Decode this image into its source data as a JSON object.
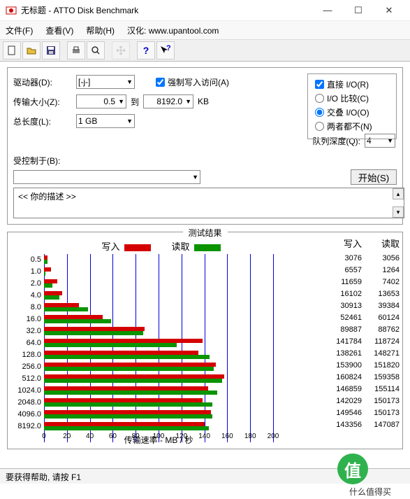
{
  "window": {
    "title": "无标题 - ATTO Disk Benchmark"
  },
  "menu": {
    "file": "文件(F)",
    "view": "查看(V)",
    "help": "帮助(H)",
    "trans_label": "汉化:",
    "trans_url": "www.upantool.com"
  },
  "labels": {
    "drive": "驱动器(D):",
    "transfer": "传输大小(Z):",
    "to": "到",
    "kb": "KB",
    "length": "总长度(L):",
    "force_write": "强制写入访问(A)",
    "direct_io": "直接 I/O(R)",
    "io_compare": "I/O 比较(C)",
    "overlap_io": "交叠 I/O(O)",
    "neither": "两者都不(N)",
    "queue_depth": "队列深度(Q):",
    "controlled": "受控制于(B):",
    "start": "开始(S)",
    "desc": "<<   你的描述   >>",
    "results_title": "测试结果",
    "write": "写入",
    "read": "读取",
    "xaxis": "传输速率 - MB / 秒",
    "status": "要获得帮助, 请按 F1"
  },
  "values": {
    "drive": "[-j-]",
    "size_from": "0.5",
    "size_to": "8192.0",
    "length": "1 GB",
    "queue": "4"
  },
  "watermark": {
    "symbol": "值",
    "text": "什么值得买"
  },
  "chart_data": {
    "type": "bar",
    "xlabel": "传输速率 - MB / 秒",
    "xlim": [
      0,
      200
    ],
    "xticks": [
      0,
      20,
      40,
      60,
      80,
      100,
      120,
      140,
      160,
      180,
      200
    ],
    "categories": [
      "0.5",
      "1.0",
      "2.0",
      "4.0",
      "8.0",
      "16.0",
      "32.0",
      "64.0",
      "128.0",
      "256.0",
      "512.0",
      "1024.0",
      "2048.0",
      "4096.0",
      "8192.0"
    ],
    "series": [
      {
        "name": "写入",
        "color": "#d40000",
        "values_kb": [
          3076,
          6557,
          11659,
          16102,
          30913,
          52461,
          89887,
          141784,
          138261,
          153900,
          160824,
          146859,
          142029,
          149546,
          143356
        ],
        "bar_mb": [
          3.0,
          6.4,
          11.4,
          15.7,
          30.2,
          51.2,
          87.8,
          138.5,
          135.0,
          150.3,
          157.1,
          143.4,
          138.7,
          146.0,
          140.0
        ]
      },
      {
        "name": "读取",
        "color": "#0a9400",
        "values_kb": [
          3056,
          1264,
          7402,
          13653,
          39384,
          60124,
          88762,
          118724,
          148271,
          151820,
          159358,
          155114,
          150173,
          150173,
          147087
        ],
        "bar_mb": [
          3.0,
          1.2,
          7.2,
          13.3,
          38.5,
          58.7,
          86.7,
          115.9,
          144.8,
          148.3,
          155.6,
          151.5,
          146.7,
          146.7,
          143.6
        ]
      }
    ]
  }
}
